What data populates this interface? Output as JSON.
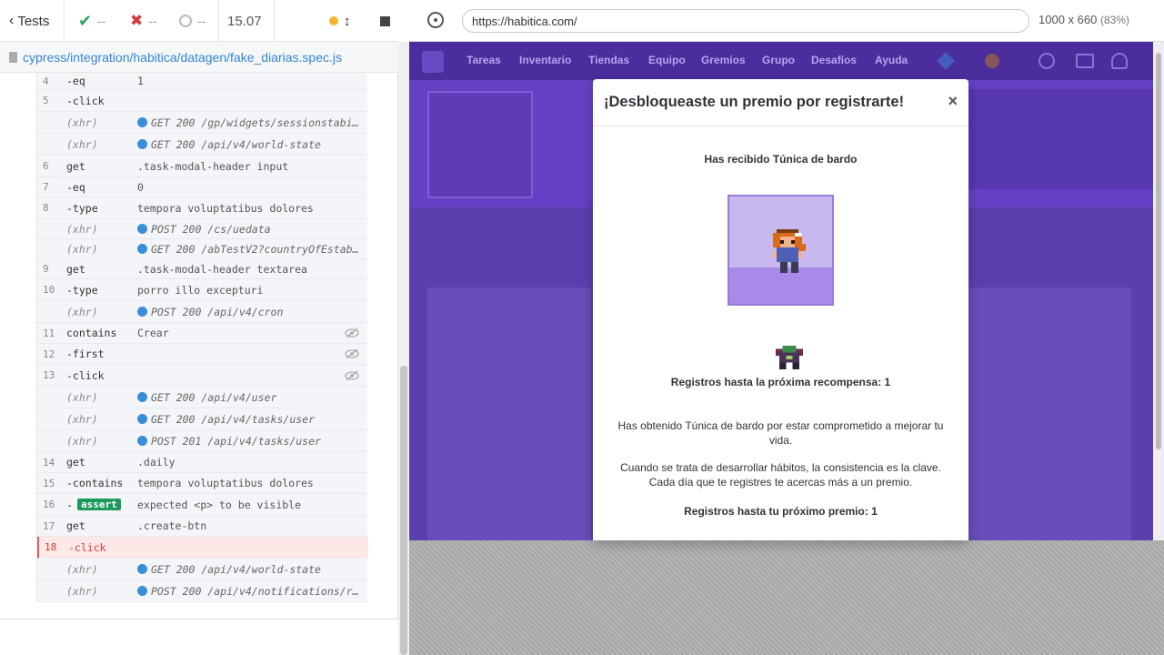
{
  "runner": {
    "back_label": "Tests",
    "passed": "--",
    "failed": "--",
    "pending": "--",
    "duration": "15.07",
    "spec_path": "cypress/integration/habitica/datagen/fake_diarias.spec.js"
  },
  "commands": [
    {
      "num": "4",
      "name": "-eq",
      "msg": "1"
    },
    {
      "num": "5",
      "name": "-click",
      "msg": ""
    },
    {
      "num": "",
      "name": "(xhr)",
      "msg": "GET 200 /gp/widgets/sessionstabili…",
      "xhr": true
    },
    {
      "num": "",
      "name": "(xhr)",
      "msg": "GET 200 /api/v4/world-state",
      "xhr": true
    },
    {
      "num": "6",
      "name": "get",
      "msg": ".task-modal-header input"
    },
    {
      "num": "7",
      "name": "-eq",
      "msg": "0"
    },
    {
      "num": "8",
      "name": "-type",
      "msg": "tempora voluptatibus dolores"
    },
    {
      "num": "",
      "name": "(xhr)",
      "msg": "POST 200 /cs/uedata",
      "xhr": true
    },
    {
      "num": "",
      "name": "(xhr)",
      "msg": "GET 200 /abTestV2?countryOfEstablishment…",
      "xhr": true
    },
    {
      "num": "9",
      "name": "get",
      "msg": ".task-modal-header textarea"
    },
    {
      "num": "10",
      "name": "-type",
      "msg": "porro illo excepturi"
    },
    {
      "num": "",
      "name": "(xhr)",
      "msg": "POST 200 /api/v4/cron",
      "xhr": true
    },
    {
      "num": "11",
      "name": "contains",
      "msg": "Crear"
    },
    {
      "num": "12",
      "name": "-first",
      "msg": ""
    },
    {
      "num": "13",
      "name": "-click",
      "msg": ""
    },
    {
      "num": "",
      "name": "(xhr)",
      "msg": "GET 200 /api/v4/user",
      "xhr": true
    },
    {
      "num": "",
      "name": "(xhr)",
      "msg": "GET 200 /api/v4/tasks/user",
      "xhr": true
    },
    {
      "num": "",
      "name": "(xhr)",
      "msg": "POST 201 /api/v4/tasks/user",
      "xhr": true
    },
    {
      "num": "14",
      "name": "get",
      "msg": ".daily"
    },
    {
      "num": "15",
      "name": "-contains",
      "msg": "tempora voluptatibus dolores"
    },
    {
      "num": "16",
      "name": "-",
      "assert": "assert",
      "msg": "expected <p> to be visible"
    },
    {
      "num": "17",
      "name": "get",
      "msg": ".create-btn"
    },
    {
      "num": "18",
      "name": "-click",
      "msg": "",
      "fail": true
    },
    {
      "num": "",
      "name": "(xhr)",
      "msg": "GET 200 /api/v4/world-state",
      "xhr": true
    },
    {
      "num": "",
      "name": "(xhr)",
      "msg": "POST 200 /api/v4/notifications/read",
      "xhr": true
    }
  ],
  "browser": {
    "url": "https://habitica.com/",
    "viewport": "1000 x 660",
    "scale": "(83%)"
  },
  "app_nav": [
    "Tareas",
    "Inventario",
    "Tiendas",
    "Equipo",
    "Gremios",
    "Grupo",
    "Desafíos",
    "Ayuda"
  ],
  "modal": {
    "title": "¡Desbloqueaste un premio por registrarte!",
    "close": "×",
    "received": "Has recibido Túnica de bardo",
    "next_reward": "Registros hasta la próxima recompensa: 1",
    "obtained": "Has obtenido Túnica de bardo por estar comprometido a mejorar tu vida.",
    "consistency": "Cuando se trata de desarrollar hábitos, la consistencia es la clave. Cada día que te registres te acercas más a un premio.",
    "next_prize": "Registros hasta tu próximo premio: 1"
  },
  "colors": {
    "modal_purple": "#c8b8f0",
    "app_purple": "#5a3ea8",
    "cypress_blue": "#3386d4",
    "pass_green": "#1d9a5b",
    "fail_red": "#d43a3a"
  }
}
